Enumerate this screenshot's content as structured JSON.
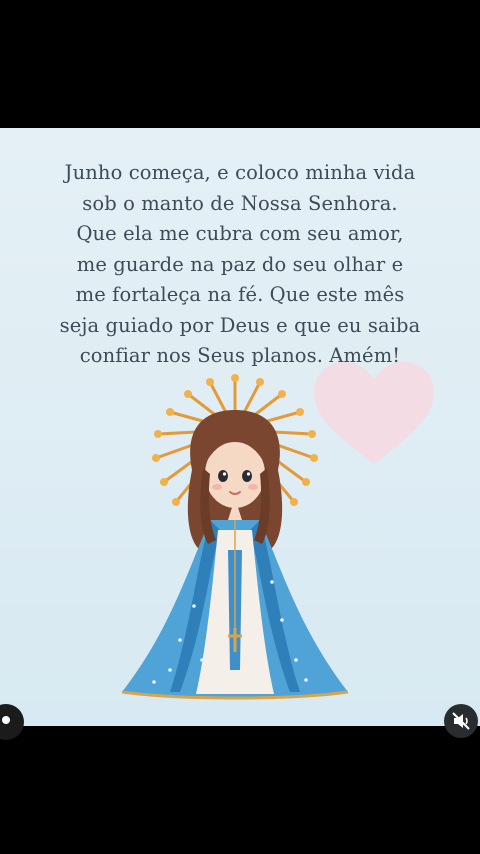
{
  "post": {
    "prayer_lines": [
      "Junho começa, e coloco minha vida",
      "sob o manto de Nossa Senhora.",
      "Que ela me cubra com seu amor,",
      "me guarde na paz do seu olhar e",
      "me fortaleça na fé. Que este mês",
      "seja guiado por Deus e que eu saiba",
      "confiar nos Seus planos. Amém!"
    ]
  },
  "controls": {
    "mute_icon": "speaker-muted-icon",
    "avatar_icon": "profile-dot-icon"
  },
  "colors": {
    "text": "#3d4a57",
    "background": "#dfedf4",
    "heart": "#f7d8e0",
    "mantle": "#4fa3d6",
    "halo": "#e39a3a"
  }
}
